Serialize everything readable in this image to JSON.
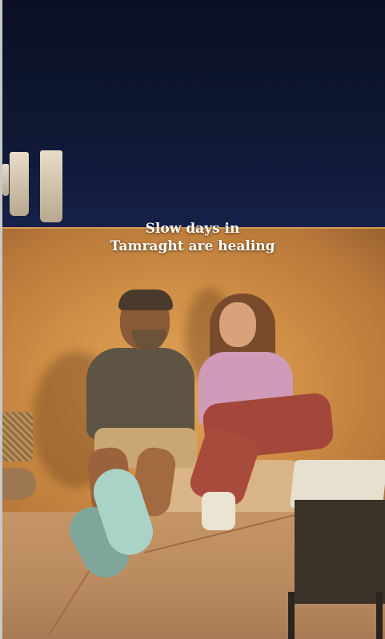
{
  "caption": {
    "line1": "Slow days in",
    "line2": "Tamraght are healing"
  },
  "colors": {
    "sky": "#0a0f24",
    "wall": "#cf8e45",
    "caption_text": "#ffffff"
  }
}
